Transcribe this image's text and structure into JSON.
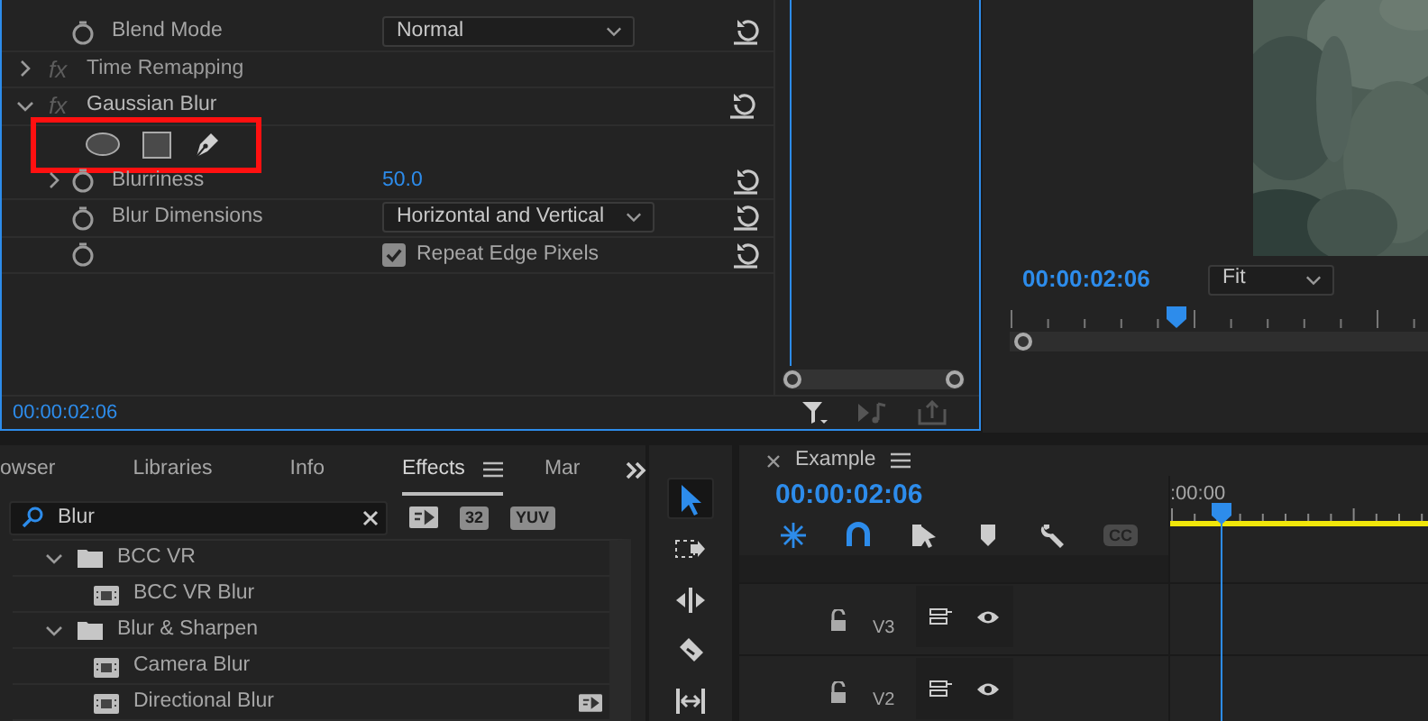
{
  "effect_controls": {
    "rows": [
      {
        "kind": "dropdown",
        "label": "Blend Mode",
        "value": "Normal"
      },
      {
        "kind": "effect",
        "badge": "fx",
        "label": "Time Remapping",
        "expanded": false
      },
      {
        "kind": "effect",
        "badge": "fx",
        "label": "Gaussian Blur",
        "expanded": true
      },
      {
        "kind": "mask_tools",
        "highlighted": true
      },
      {
        "kind": "number",
        "label": "Blurriness",
        "value": "50.0",
        "expanded": false
      },
      {
        "kind": "dropdown",
        "label": "Blur Dimensions",
        "value": "Horizontal and Vertical"
      },
      {
        "kind": "checkbox",
        "label": "Repeat Edge Pixels",
        "checked": true
      }
    ],
    "timecode": "00:00:02:06"
  },
  "program_monitor": {
    "timecode": "00:00:02:06",
    "zoom": "Fit"
  },
  "effects_panel": {
    "tabs": [
      {
        "label": "owser",
        "selected": false
      },
      {
        "label": "Libraries",
        "selected": false
      },
      {
        "label": "Info",
        "selected": false
      },
      {
        "label": "Effects",
        "selected": true
      },
      {
        "label": "Mar",
        "selected": false
      }
    ],
    "search": {
      "value": "Blur"
    },
    "filter_badges": [
      "32",
      "YUV"
    ],
    "tree": [
      {
        "label": "BCC VR",
        "expanded": true,
        "children": [
          {
            "label": "BCC VR Blur",
            "accelerated": false
          }
        ]
      },
      {
        "label": "Blur & Sharpen",
        "expanded": true,
        "children": [
          {
            "label": "Camera Blur",
            "accelerated": false
          },
          {
            "label": "Directional Blur",
            "accelerated": true
          }
        ]
      }
    ]
  },
  "tools": [
    {
      "kind": "selection",
      "selected": true
    },
    {
      "kind": "track_select",
      "selected": false
    },
    {
      "kind": "ripple",
      "selected": false
    },
    {
      "kind": "razor",
      "selected": false
    },
    {
      "kind": "slip",
      "selected": false
    }
  ],
  "timeline": {
    "title": "Example",
    "timecode": "00:00:02:06",
    "toolbar": [
      {
        "kind": "nest"
      },
      {
        "kind": "snap"
      },
      {
        "kind": "linked"
      },
      {
        "kind": "marker"
      },
      {
        "kind": "settings"
      },
      {
        "kind": "captions",
        "label": "CC"
      }
    ],
    "ruler_label": ":00:00",
    "tracks": [
      {
        "name": "V3"
      },
      {
        "name": "V2"
      }
    ]
  }
}
